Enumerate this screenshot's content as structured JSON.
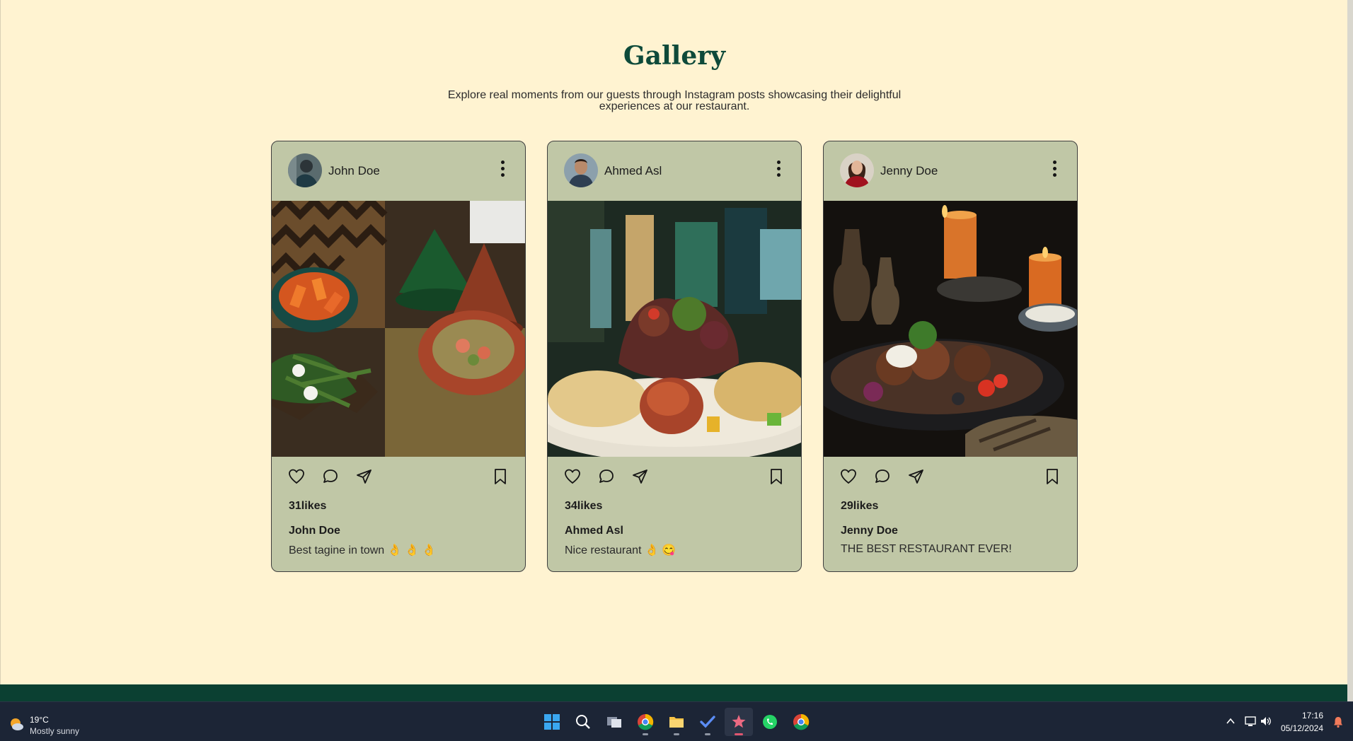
{
  "gallery": {
    "title": "Gallery",
    "subtitle": "Explore real moments from our guests through Instagram posts showcasing their delightful experiences at our restaurant."
  },
  "posts": [
    {
      "username": "John Doe",
      "likes": "31likes",
      "caption_user": "John Doe",
      "caption": "Best tagine in town 👌 👌 👌"
    },
    {
      "username": "Ahmed Asl",
      "likes": "34likes",
      "caption_user": "Ahmed Asl",
      "caption": "Nice restaurant 👌 😋"
    },
    {
      "username": "Jenny Doe",
      "likes": "29likes",
      "caption_user": "Jenny Doe",
      "caption": "THE BEST RESTAURANT EVER!"
    }
  ],
  "taskbar": {
    "weather_temp": "19°C",
    "weather_desc": "Mostly sunny",
    "time": "17:16",
    "date": "05/12/2024"
  },
  "colors": {
    "page_bg": "#fff3d1",
    "card_bg": "#c0c7a6",
    "title": "#0e4a3a",
    "footer": "#0b4032",
    "taskbar": "#1c2536"
  }
}
